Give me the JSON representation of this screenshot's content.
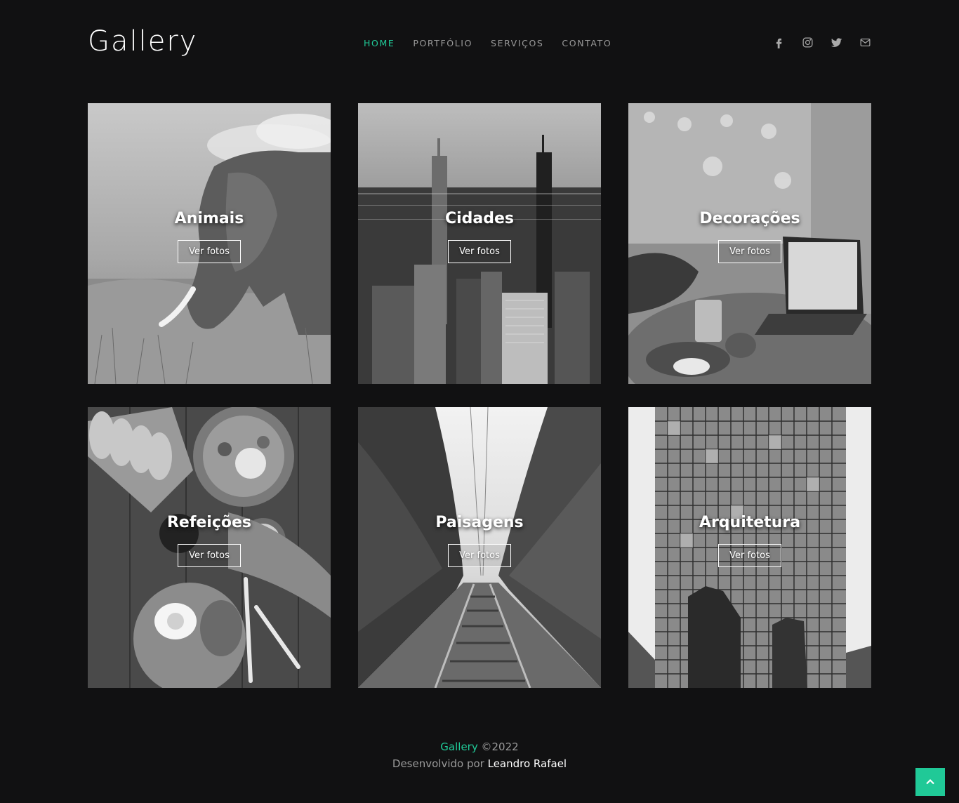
{
  "brand": {
    "logo": "Gallery"
  },
  "nav": {
    "items": [
      {
        "label": "HOME",
        "active": true
      },
      {
        "label": "PORTFÓLIO",
        "active": false
      },
      {
        "label": "SERVIÇOS",
        "active": false
      },
      {
        "label": "CONTATO",
        "active": false
      }
    ]
  },
  "social": [
    "facebook-icon",
    "instagram-icon",
    "twitter-icon",
    "envelope-icon"
  ],
  "gallery": {
    "button_label": "Ver fotos",
    "cards": [
      {
        "title": "Animais",
        "image": "elephant-photo"
      },
      {
        "title": "Cidades",
        "image": "city-skyline-photo"
      },
      {
        "title": "Decorações",
        "image": "cafe-laptop-photo"
      },
      {
        "title": "Refeições",
        "image": "breakfast-table-photo"
      },
      {
        "title": "Paisagens",
        "image": "railway-forest-photo"
      },
      {
        "title": "Arquitetura",
        "image": "glass-tower-photo"
      }
    ]
  },
  "footer": {
    "brand": "Gallery",
    "copyright": "©2022",
    "developed_by": "Desenvolvido por",
    "author": "Leandro Rafael"
  },
  "colors": {
    "accent": "#20c997",
    "background": "#111112"
  }
}
